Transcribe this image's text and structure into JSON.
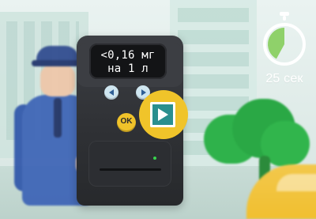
{
  "device": {
    "display_line_1": "<0,16 мг",
    "display_line_2": "на 1 л",
    "ok_label": "OK",
    "left_button_icon": "triangle-left-icon",
    "right_button_icon": "triangle-right-icon"
  },
  "overlay": {
    "play_icon": "play-icon",
    "accent": "#f0c42a",
    "inner_color": "#2a8f8e"
  },
  "timer": {
    "label": "25 сек",
    "icon": "stopwatch-icon",
    "progress_fraction": 0.42,
    "progress_color": "#8fd16a"
  }
}
